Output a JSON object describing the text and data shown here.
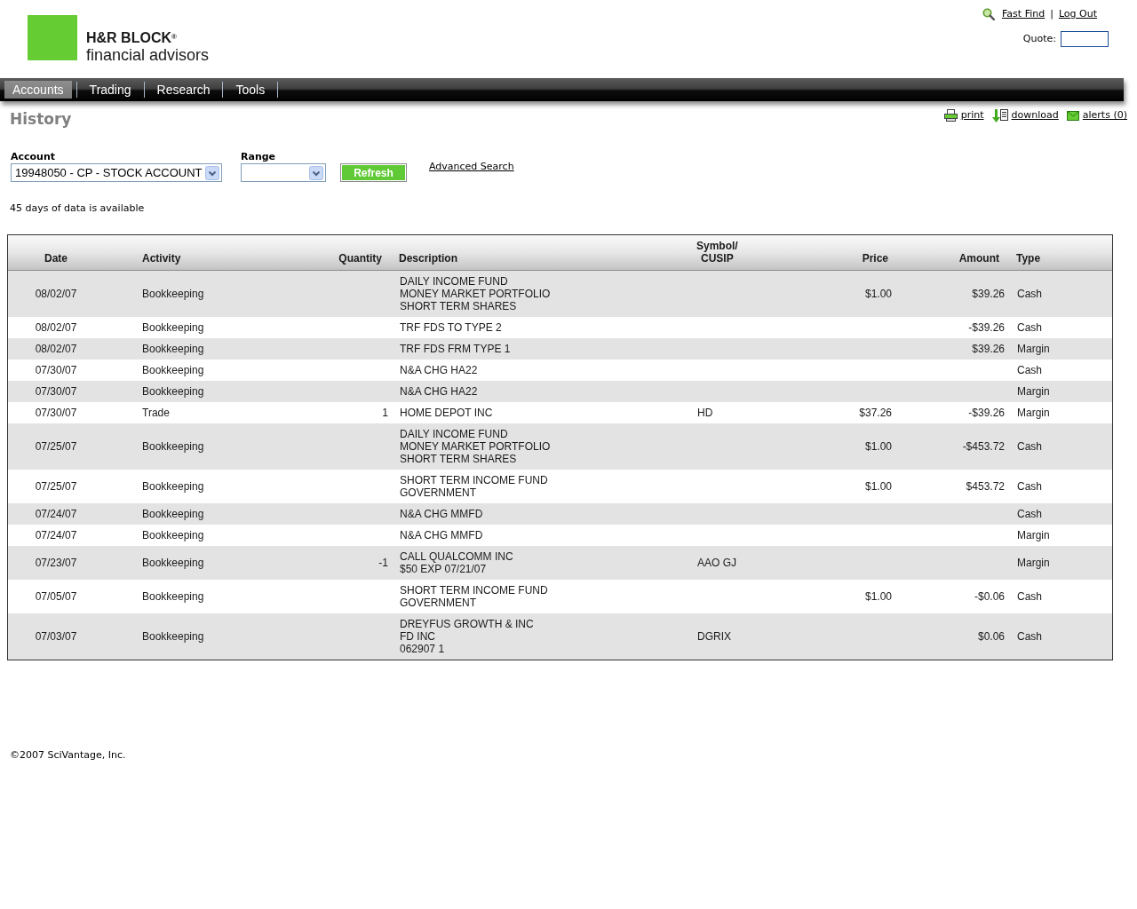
{
  "header": {
    "logo": {
      "brand": "H&R BLOCK$^{®}$",
      "tagline": "financial advisors"
    },
    "links": [
      {
        "label": "Fast Find"
      },
      {
        "label": "Log Out"
      }
    ],
    "separator": "|",
    "quote": {
      "label": "Quote:"
    }
  },
  "nav": {
    "tabs": [
      {
        "label": "Accounts",
        "selected": true
      },
      {
        "label": "Trading",
        "selected": false
      },
      {
        "label": "Research",
        "selected": false
      },
      {
        "label": "Tools",
        "selected": false
      }
    ]
  },
  "page": {
    "title": "History",
    "actions": [
      {
        "kind": "print",
        "label": "print"
      },
      {
        "kind": "download",
        "label": "download"
      },
      {
        "kind": "alerts",
        "label": "alerts (0)"
      }
    ]
  },
  "filters": {
    "account": {
      "label": "Account",
      "value": "19948050 - CP - STOCK ACCOUNT"
    },
    "range": {
      "label": "Range"
    },
    "refresh_button": "Refresh",
    "advanced_search": "Advanced Search"
  },
  "notice": "45 days of data is available",
  "table": {
    "columns": [
      {
        "label": "Date"
      },
      {
        "label": "Activity"
      },
      {
        "label": "Quantity"
      },
      {
        "label": "Description"
      },
      {
        "label": "Symbol/ CUSIP"
      },
      {
        "label": "Price"
      },
      {
        "label": "Amount"
      },
      {
        "label": "Type"
      }
    ],
    "rows": [
      {
        "date": "08/02/07",
        "activity": "Bookkeeping",
        "description": [
          "DAILY INCOME FUND",
          "MONEY MARKET PORTFOLIO",
          "SHORT TERM SHARES"
        ],
        "price": "$1.00",
        "amount": "$39.26",
        "type": "Cash"
      },
      {
        "date": "08/02/07",
        "activity": "Bookkeeping",
        "description": [
          "TRF FDS TO TYPE 2"
        ],
        "amount": "-$39.26",
        "type": "Cash"
      },
      {
        "date": "08/02/07",
        "activity": "Bookkeeping",
        "description": [
          "TRF FDS FRM TYPE 1"
        ],
        "amount": "$39.26",
        "type": "Margin"
      },
      {
        "date": "07/30/07",
        "activity": "Bookkeeping",
        "description": [
          "N&A CHG HA22"
        ],
        "type": "Cash"
      },
      {
        "date": "07/30/07",
        "activity": "Bookkeeping",
        "description": [
          "N&A CHG HA22"
        ],
        "type": "Margin"
      },
      {
        "date": "07/30/07",
        "activity": "Trade",
        "quantity": "1",
        "description": [
          "HOME DEPOT INC"
        ],
        "symbol": "HD",
        "price": "$37.26",
        "amount": "-$39.26",
        "type": "Margin"
      },
      {
        "date": "07/25/07",
        "activity": "Bookkeeping",
        "description": [
          "DAILY INCOME FUND",
          "MONEY MARKET PORTFOLIO",
          "SHORT TERM SHARES"
        ],
        "price": "$1.00",
        "amount": "-$453.72",
        "type": "Cash"
      },
      {
        "date": "07/25/07",
        "activity": "Bookkeeping",
        "description": [
          "SHORT TERM INCOME FUND",
          "GOVERNMENT"
        ],
        "price": "$1.00",
        "amount": "$453.72",
        "type": "Cash"
      },
      {
        "date": "07/24/07",
        "activity": "Bookkeeping",
        "description": [
          "N&A CHG MMFD"
        ],
        "type": "Cash"
      },
      {
        "date": "07/24/07",
        "activity": "Bookkeeping",
        "description": [
          "N&A CHG MMFD"
        ],
        "type": "Margin"
      },
      {
        "date": "07/23/07",
        "activity": "Bookkeeping",
        "quantity": "-1",
        "description": [
          "CALL QUALCOMM INC",
          "$50 EXP 07/21/07"
        ],
        "symbol": "AAO GJ",
        "type": "Margin"
      },
      {
        "date": "07/05/07",
        "activity": "Bookkeeping",
        "description": [
          "SHORT TERM INCOME FUND",
          "GOVERNMENT"
        ],
        "price": "$1.00",
        "amount": "-$0.06",
        "type": "Cash"
      },
      {
        "date": "07/03/07",
        "activity": "Bookkeeping",
        "description": [
          "DREYFUS GROWTH & INC",
          "FD INC",
          "062907 1"
        ],
        "symbol": "DGRIX",
        "amount": "$0.06",
        "type": "Cash"
      }
    ]
  },
  "footer": "©2007 SciVantage, Inc."
}
